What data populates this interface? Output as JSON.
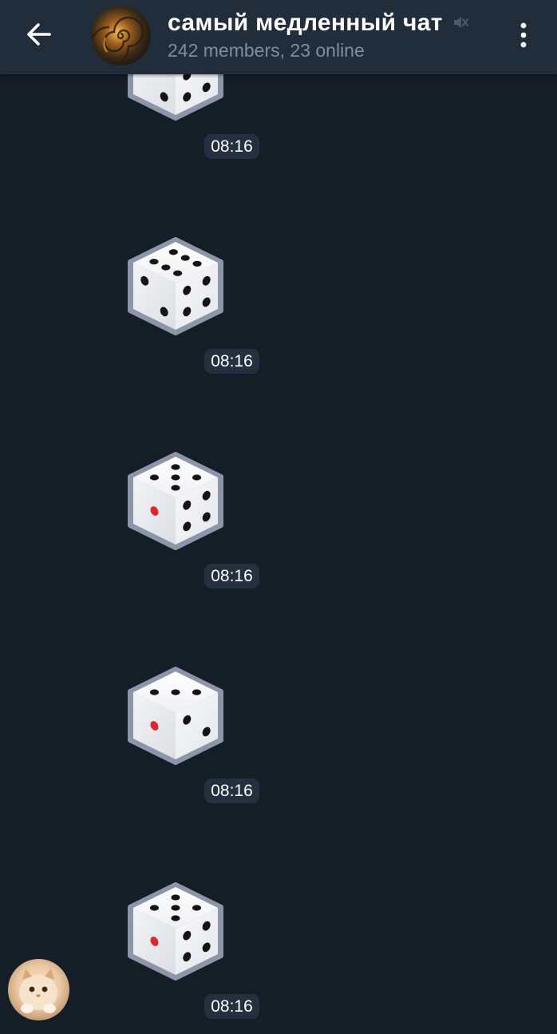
{
  "header": {
    "title": "самый медленный чат",
    "subtitle": "242 members, 23 online",
    "muted": true,
    "back_icon": "arrow-left-icon",
    "menu_icon": "more-vertical-icon"
  },
  "messages": [
    {
      "dice_value": 6,
      "time": "08:16"
    },
    {
      "dice_value": 6,
      "time": "08:16"
    },
    {
      "dice_value": 5,
      "time": "08:16"
    },
    {
      "dice_value": 3,
      "time": "08:16"
    },
    {
      "dice_value": 5,
      "time": "08:16"
    }
  ],
  "colors": {
    "background": "#151d27",
    "header": "#212d3b",
    "subtitle": "#7e8e9f",
    "time_badge": "#243040",
    "red_pip": "#e0262b"
  }
}
